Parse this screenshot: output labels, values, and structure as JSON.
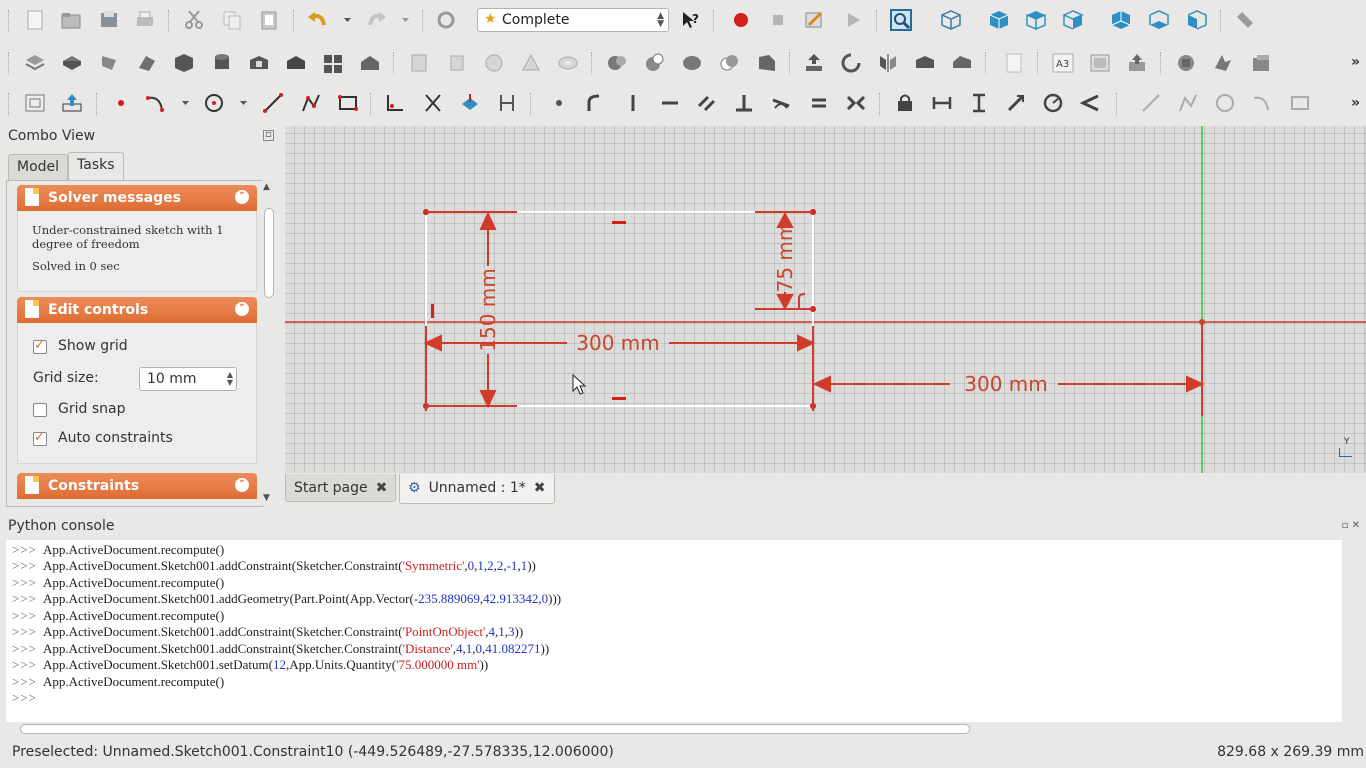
{
  "toolbar": {
    "workbench_combo": "Complete",
    "more_1": "»",
    "more_2": "»",
    "more_3": "»"
  },
  "combo_view": {
    "title": "Combo View",
    "tabs": [
      "Model",
      "Tasks"
    ],
    "active_tab": "Tasks",
    "solver": {
      "header": "Solver messages",
      "message": "Under-constrained sketch with 1 degree of freedom",
      "message_line1": "Under-constrained sketch with 1",
      "message_line2": "degree of freedom",
      "solve_time": "Solved in 0 sec"
    },
    "edit_controls": {
      "header": "Edit controls",
      "show_grid_label": "Show grid",
      "show_grid": true,
      "grid_size_label": "Grid size:",
      "grid_size_value": "10 mm",
      "grid_snap_label": "Grid snap",
      "grid_snap": false,
      "auto_constraints_label": "Auto constraints",
      "auto_constraints": true
    },
    "constraints": {
      "header": "Constraints"
    }
  },
  "viewport": {
    "dims": {
      "width_rect": "300 mm",
      "height_rect": "150 mm",
      "height_small": "75 mm",
      "distance": "300 mm"
    },
    "axis_label": "Y"
  },
  "doc_tabs": [
    {
      "label": "Start page",
      "active": false
    },
    {
      "label": "Unnamed : 1*",
      "active": true
    }
  ],
  "python_console": {
    "title": "Python console",
    "prompt": ">>>",
    "lines": [
      "App.ActiveDocument.recompute()",
      "App.ActiveDocument.Sketch001.addConstraint(Sketcher.Constraint('Symmetric',0,1,2,2,-1,1))",
      "App.ActiveDocument.recompute()",
      "App.ActiveDocument.Sketch001.addGeometry(Part.Point(App.Vector(-235.889069,42.913342,0)))",
      "App.ActiveDocument.recompute()",
      "App.ActiveDocument.Sketch001.addConstraint(Sketcher.Constraint('PointOnObject',4,1,3))",
      "App.ActiveDocument.Sketch001.addConstraint(Sketcher.Constraint('Distance',4,1,0,41.082271))",
      "App.ActiveDocument.Sketch001.setDatum(12,App.Units.Quantity('75.000000 mm'))",
      "App.ActiveDocument.recompute()",
      ""
    ]
  },
  "status": {
    "preselected": "Preselected: Unnamed.Sketch001.Constraint10 (-449.526489,-27.578335,12.006000)",
    "dimensions": "829.68 x 269.39 mm"
  },
  "colors": {
    "accent_orange": "#dd6c32",
    "sketch_red": "#c8462a",
    "axis_green": "#35c635",
    "py_string": "#c81e1e",
    "py_number": "#1d37c8"
  }
}
